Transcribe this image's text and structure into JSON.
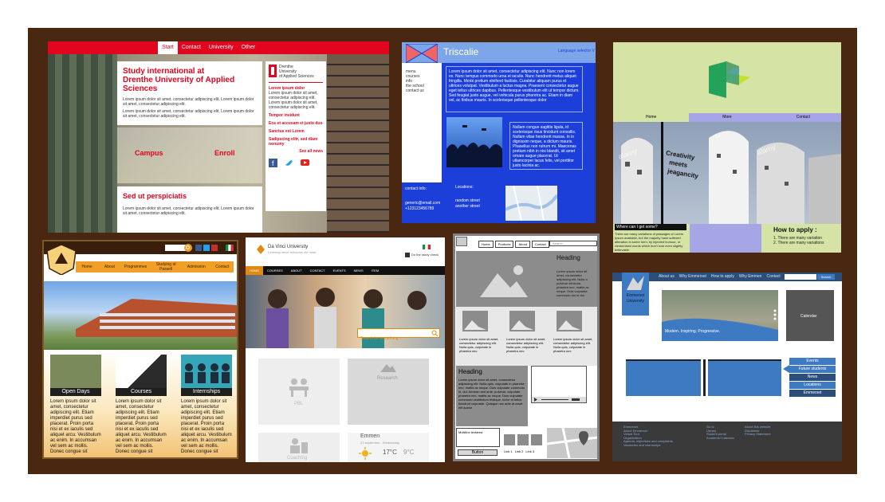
{
  "panel1": {
    "nav": [
      "Start",
      "Contact",
      "University",
      "Other"
    ],
    "title": "Study international at\nDrenthe University of Applied Sciences",
    "body": "Lorem ipsum dolor sit amet, consectetur adipiscing elit. Lorem ipsum dolor sit amet, consectetur adipiscing elit.",
    "campus": "Campus",
    "enroll": "Enroll",
    "heading2": "Sed ut perspiciatis",
    "body2": "Lorem ipsum dolor sit amet, consectetur adipiscing elit. Lorem ipsum dolor sit amet, consectetur adipiscing elit.",
    "logo_text": "Drenthe\nUniversity\nof Applied Sciences",
    "side_headings": [
      "Lorem ipsum dolor",
      "Tempor invidunt",
      "Eos et accusam et justo duo",
      "Sanctus est Lorem",
      "Sadipscing elitr, sed diam nonumy"
    ],
    "see_all": "See all news"
  },
  "panel2": {
    "title": "Triscalie",
    "language": "Language selector V",
    "menu": [
      "menu",
      "courses",
      "info",
      "the school",
      "contact us"
    ],
    "text1": "Lorem ipsum dolor sit amet, consectetur adipiscing elit. Nunc non lorem ex. Nunc tempus commodo urna et iaculis. Nunc hendrerit metus aliquet fringilla. Morbi pretium eleifend facilisis. Curabitur aliquam purus et ultrices volutpat. Vestibulum a luctus magna. Praesent consectetur augue eget tellus ultrices dapibus. Pellentesque vestibulum elit ut tempor dictum. Sed feugiat justo augue, vel vehicula purus pharetra ac. Etiam in diam vel, ac finibus mauris. In scelerisque pellentesque dolor",
    "text2": "Nullam congue sagittis ligula, id scelerisque risus tincidunt convallis. Nullam vitae hendrerit massa. In in dignissim neque, a dictum mauris. Phasellus non rutrum mi. Maecenas pretium nibh in nisi blandit, sit amet ornare augue placerat. Ut ullamcorper lacus felis, vel porttitor justo lacinia ac.",
    "contact_label": "contact info:",
    "email": "generic@email.com",
    "phone": "+123123456789",
    "locations_label": "Locations:",
    "streets": [
      "random street",
      "another street"
    ]
  },
  "panel3": {
    "nav": [
      "Home",
      "More",
      "Contact"
    ],
    "hero_lines": [
      "Creativity",
      "meets",
      "jeagancity"
    ],
    "watermark": "alamy",
    "where": "Where can I get some?",
    "where_text": "There are many variations of passages of Lorem Ipsum available, but the majority have suffered alteration in some form, by injected humour, or randomised words which don't look even slightly believable.",
    "apply_title": "How to apply :",
    "apply_items": [
      "1. There are many variation",
      "2. There are many variations"
    ],
    "colors": {
      "bg": "#d5e3a5",
      "nav": "#8f8fd4",
      "apply_bg": "#a6a6e6"
    }
  },
  "panel4": {
    "logo_text": "TOMVELDE\nUNIVERSITY",
    "nav": [
      "Home",
      "About",
      "Programmes",
      "Studying at Passell",
      "Admission",
      "Contact"
    ],
    "cards": [
      "Open Days",
      "Courses",
      "Internships"
    ],
    "card_text": "Lorem ipsum dolor sit amet, consectetur adipiscing elit. Etiam imperdiet purus sed placerat. Proin porta nisi et ex iaculis sed aliquet arcu. Vestibulum ac enim. In accumsan vel sem ac mollis. Donec congue sit"
  },
  "panel5": {
    "brand": "Da Vinci University",
    "tagline": "Learning never exhausts the mind",
    "study_check": "Do the study check",
    "nav": [
      "HOME",
      "COURSES",
      "ABOUT",
      "CONTACT",
      "EVENTS",
      "NEWS",
      "ITEM"
    ],
    "search_placeholder": "Search for something",
    "tiles": [
      "PBL",
      "Research",
      "Coaching"
    ],
    "city": "Emmen",
    "date": "27 september - Wednesday",
    "temp": "17°C",
    "temp_low": "9°C"
  },
  "panel6": {
    "tabs": [
      "Home",
      "Products",
      "About",
      "Contact"
    ],
    "search_placeholder": "Search",
    "heading": "Heading",
    "side_text": "Lorem ipsum dolor sit amet, consectetur adipiscing elit. Nulla a pulvinar vehicula, pharetra nec, mattis ac neque. Duis vulputate commodo dui id dui",
    "grid_text": "Lorem ipsum dolor sit amet, consectetur adipiscing elit. Nulla quis, vulputate in pharetra nec",
    "heading2": "Heading",
    "body2": "Lorem ipsum dolor sit amet, consectetur adipiscing elit. Nulla quis, vulputate in pharetra nec, mattis ac neque. Duis vulputate commodo id, dui. Aenean sed ante, pulvinar, vulputate, pharetra nec, mattis ac neque. Duis vulputate commodo vestibulum tristique, tortor et tellus tincidunt vulputate. Quisque nec ante at amet elit auctor",
    "textarea": "Multiline textarea",
    "button": "Button",
    "links": [
      "Link 1",
      "Link 2",
      "Link 3"
    ]
  },
  "panel7": {
    "nav": [
      "About us",
      "Why Emmerset",
      "How to apply",
      "Why Emmen",
      "Contact"
    ],
    "search_button": "Search",
    "logo_text": "Emmerset\nUniversity",
    "tagline": "Modern. Inspiring. Progressive.",
    "calendar": "Calendar",
    "side_menu": [
      "Events",
      "Future students",
      "News",
      "Locations",
      "Emmerset"
    ],
    "footer": [
      {
        "title": "Emmerset",
        "items": [
          "About Emmerset",
          "Virtual Tour",
          "Organization",
          "Agenda, objectives and complaints",
          "Vacancies and internships"
        ]
      },
      {
        "title": "Go to",
        "items": [
          "Library",
          "Student portal",
          "Academic Calendar"
        ]
      },
      {
        "title": "About this website",
        "items": [
          "Disclaimer",
          "Privacy Statement"
        ]
      }
    ]
  }
}
